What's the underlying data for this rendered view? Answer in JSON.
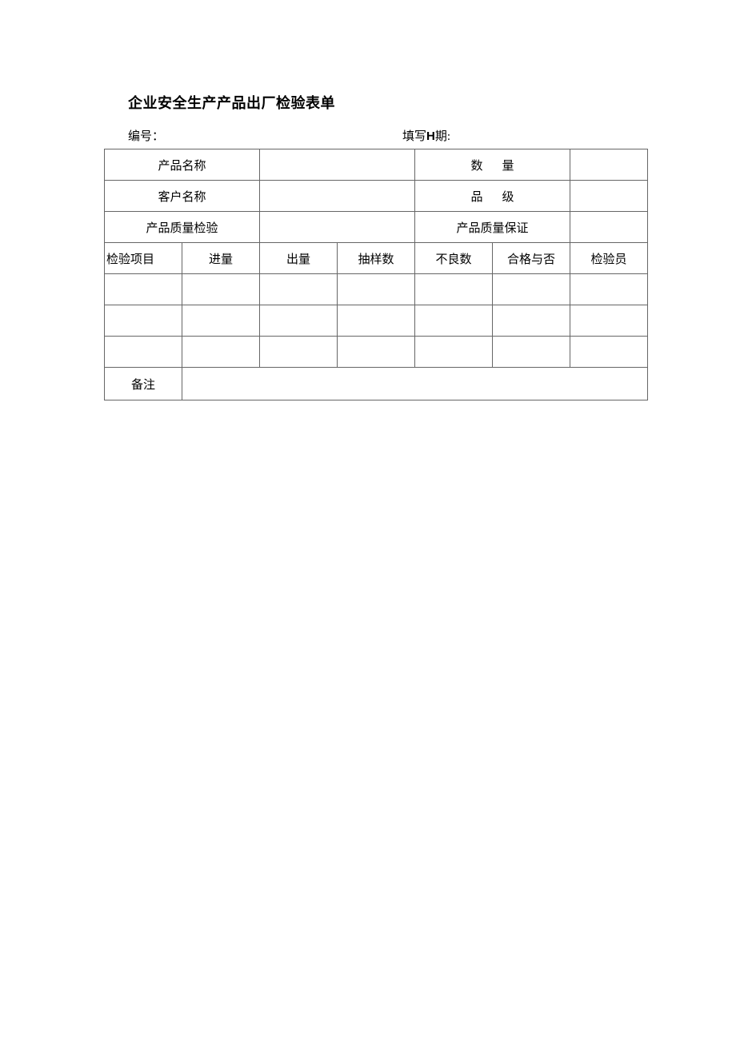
{
  "title": "企业安全生产产品出厂检验表单",
  "meta": {
    "serial_label": "编号：",
    "date_label_prefix": "填写",
    "date_label_h": "H",
    "date_label_suffix": "期:"
  },
  "rows": {
    "r1_label": "产品名称",
    "r1_value": "",
    "r1_right_label": "数量",
    "r1_right_value": "",
    "r2_label": "客户名称",
    "r2_value": "",
    "r2_right_label": "品级",
    "r2_right_value": "",
    "r3_label": "产品质量检验",
    "r3_value": "",
    "r3_right_label": "产品质量保证",
    "r3_right_value": ""
  },
  "headers": {
    "h1": "检验项目",
    "h2": "进量",
    "h3": "出量",
    "h4": "抽样数",
    "h5": "不良数",
    "h6": "合格与否",
    "h7": "检验员"
  },
  "data_rows": [
    {
      "c1": "",
      "c2": "",
      "c3": "",
      "c4": "",
      "c5": "",
      "c6": "",
      "c7": ""
    },
    {
      "c1": "",
      "c2": "",
      "c3": "",
      "c4": "",
      "c5": "",
      "c6": "",
      "c7": ""
    },
    {
      "c1": "",
      "c2": "",
      "c3": "",
      "c4": "",
      "c5": "",
      "c6": "",
      "c7": ""
    }
  ],
  "footer": {
    "label": "备注",
    "value": ""
  }
}
